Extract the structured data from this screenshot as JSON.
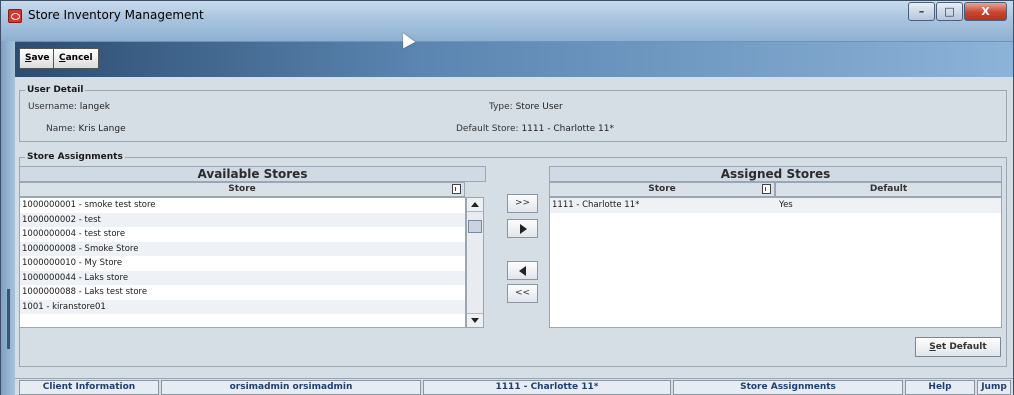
{
  "window": {
    "title": "Store Inventory Management",
    "controls": {
      "minimize": "–",
      "maximize": "□",
      "close": "X"
    }
  },
  "toolbar": {
    "save_label": "Save",
    "cancel_label": "Cancel"
  },
  "user_detail": {
    "group_title": "User Detail",
    "username_label": "Username:",
    "username_value": "langek",
    "name_label": "Name:",
    "name_value": "Kris Lange",
    "type_label": "Type:",
    "type_value": "Store User",
    "default_store_label": "Default Store:",
    "default_store_value": "1111 - Charlotte 11*"
  },
  "store_assignments": {
    "group_title": "Store Assignments",
    "available": {
      "title": "Available Stores",
      "column": "Store",
      "rows": [
        "1000000001 - smoke test store",
        "1000000002 - test",
        "1000000004 - test store",
        "1000000008 - Smoke Store",
        "1000000010 - My Store",
        "1000000044 - Laks store",
        "1000000088 - Laks test store",
        "1001 - kiranstore01"
      ]
    },
    "move_buttons": {
      "add_all": ">>",
      "remove_all": "<<"
    },
    "assigned": {
      "title": "Assigned Stores",
      "columns": [
        "Store",
        "Default"
      ],
      "rows": [
        {
          "store": "1111 - Charlotte 11*",
          "default": "Yes"
        }
      ]
    },
    "set_default_label": "Set Default"
  },
  "statusbar": {
    "client_info": "Client Information",
    "user": "orsimadmin orsimadmin",
    "store": "1111 - Charlotte 11*",
    "screen": "Store Assignments",
    "help": "Help",
    "jump": "Jump"
  }
}
